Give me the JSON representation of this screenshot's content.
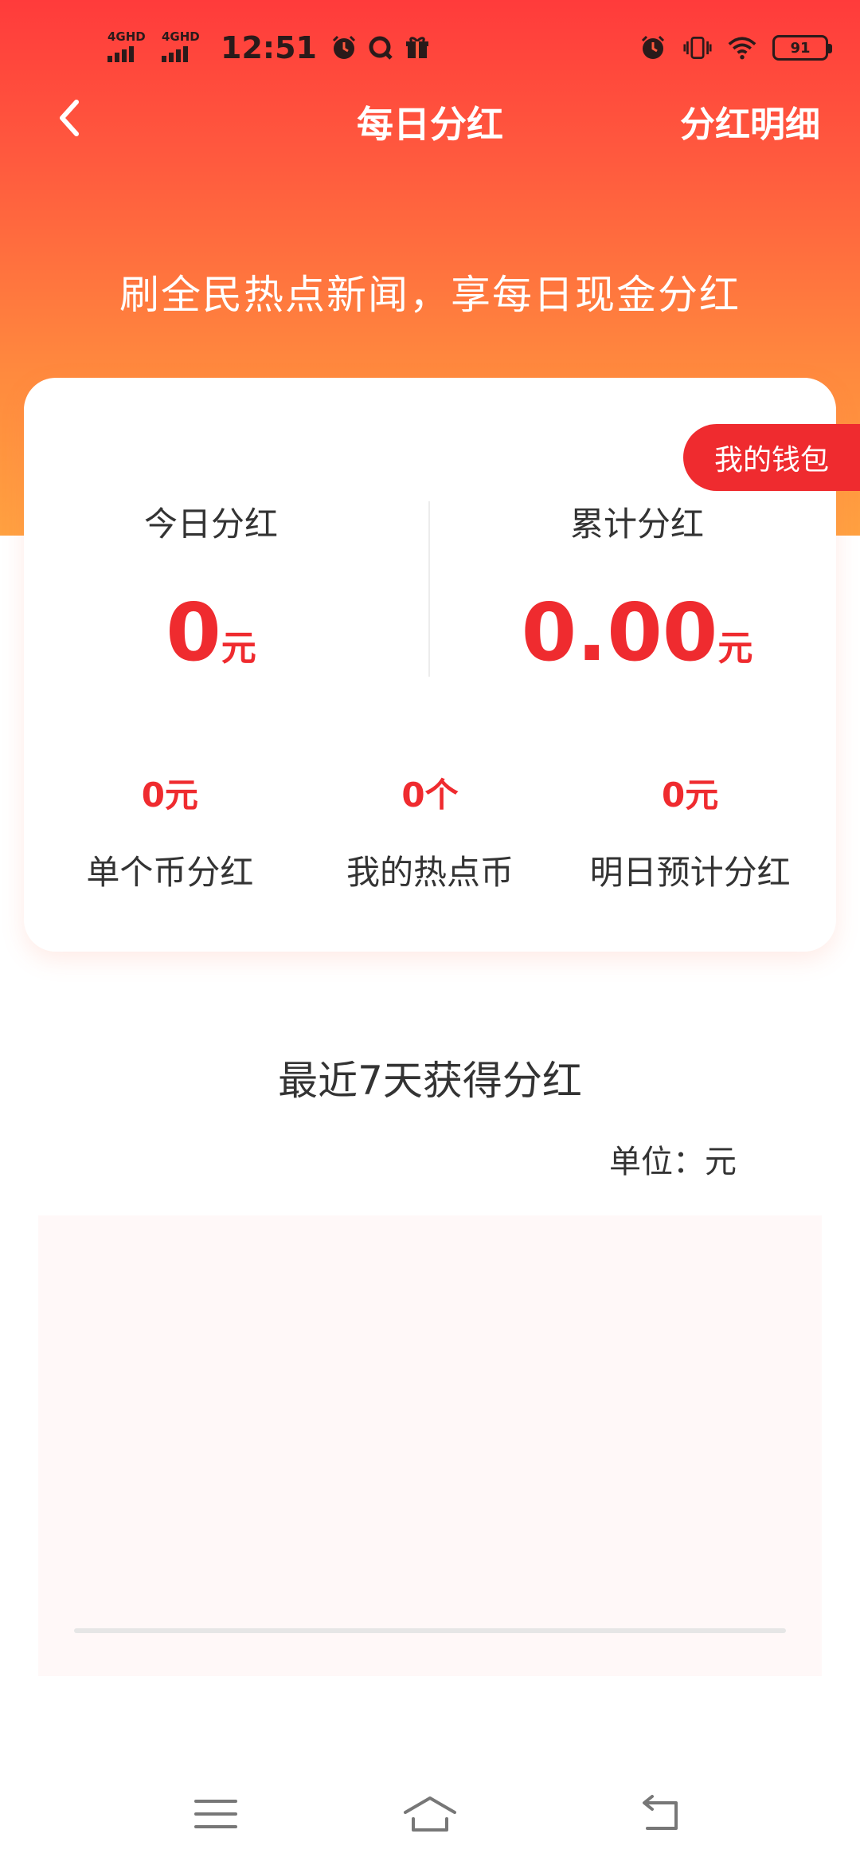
{
  "status_bar": {
    "signal1_label": "4GHD",
    "signal2_label": "4GHD",
    "time": "12:51",
    "battery": "91"
  },
  "nav": {
    "title": "每日分红",
    "detail_link": "分红明细"
  },
  "slogan": "刷全民热点新闻，享每日现金分红",
  "card": {
    "wallet_button": "我的钱包",
    "today": {
      "label": "今日分红",
      "value": "0",
      "unit": "元"
    },
    "total": {
      "label": "累计分红",
      "value": "0.00",
      "unit": "元"
    },
    "stats": [
      {
        "value": "0元",
        "label": "单个币分红"
      },
      {
        "value": "0个",
        "label": "我的热点币"
      },
      {
        "value": "0元",
        "label": "明日预计分红"
      }
    ]
  },
  "section": {
    "title": "最近7天获得分红",
    "unit_note": "单位：元"
  },
  "colors": {
    "accent": "#ef2b2f",
    "header_top": "#ff3b3b",
    "header_bottom": "#ffa141"
  }
}
